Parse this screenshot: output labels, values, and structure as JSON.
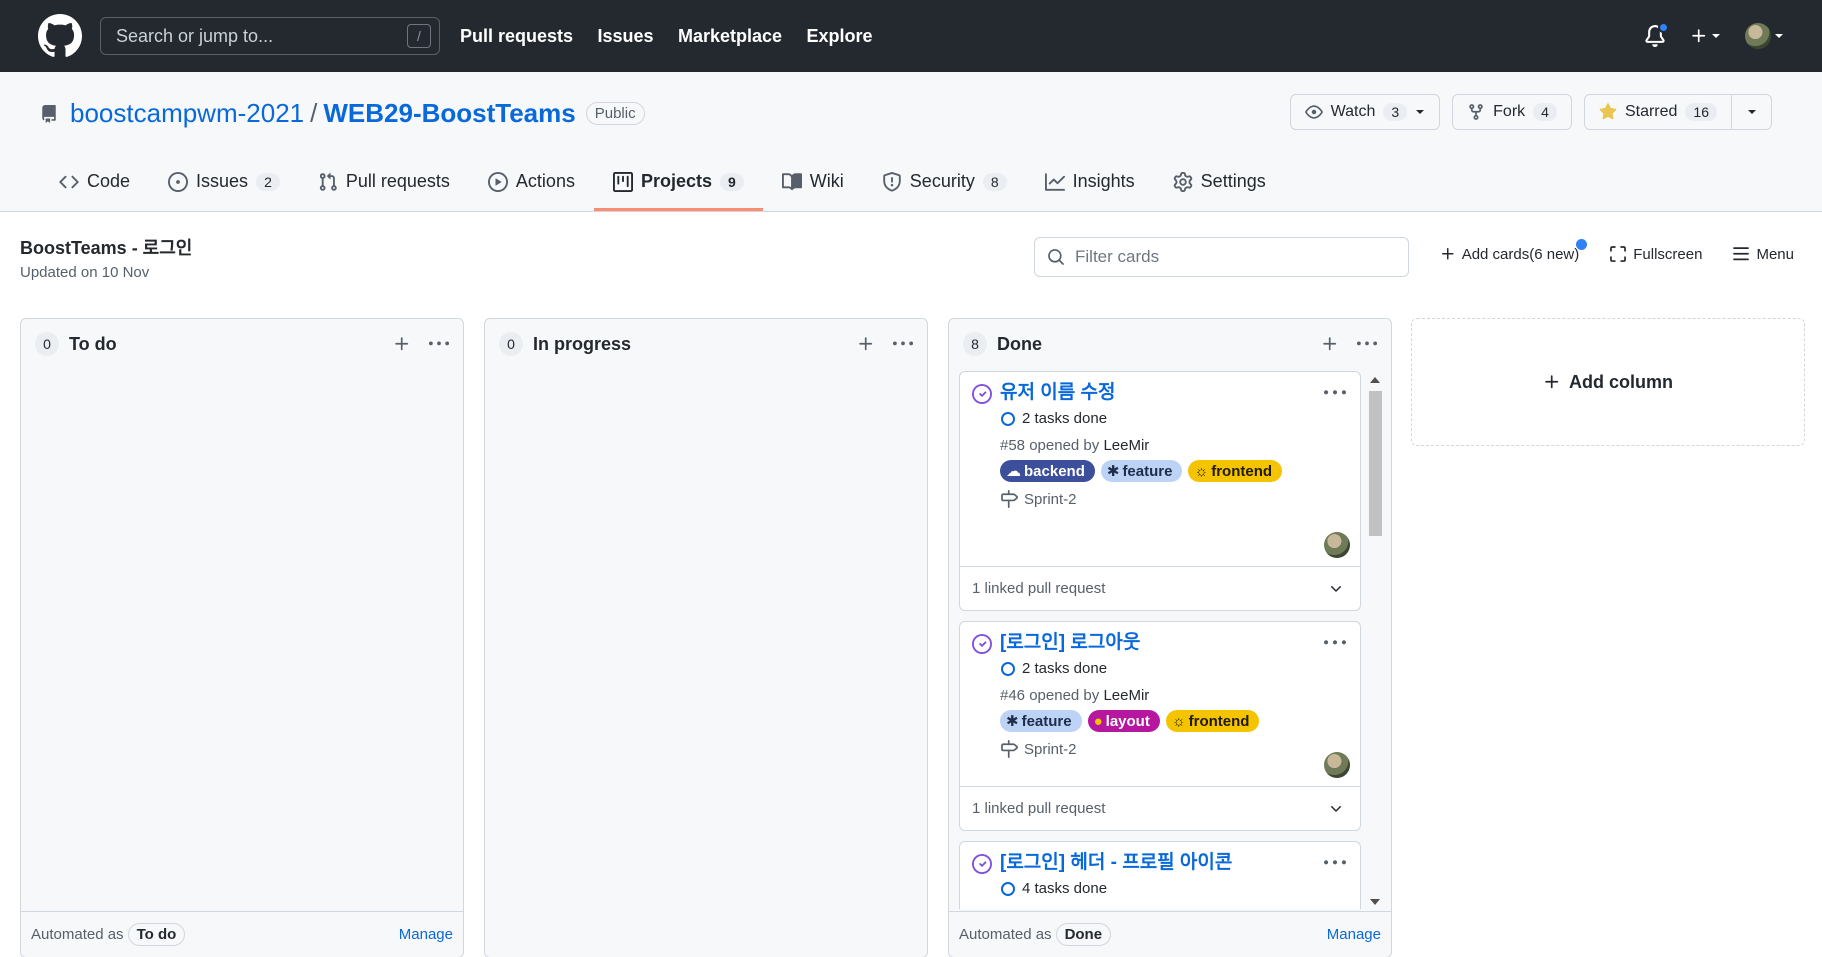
{
  "header": {
    "search_placeholder": "Search or jump to...",
    "search_shortcut": "/",
    "nav": [
      "Pull requests",
      "Issues",
      "Marketplace",
      "Explore"
    ]
  },
  "repo": {
    "owner": "boostcampwm-2021",
    "separator": "/",
    "name": "WEB29-BoostTeams",
    "visibility": "Public",
    "watch": {
      "label": "Watch",
      "count": "3"
    },
    "fork": {
      "label": "Fork",
      "count": "4"
    },
    "star": {
      "label": "Starred",
      "count": "16"
    }
  },
  "tabs": [
    {
      "label": "Code",
      "count": ""
    },
    {
      "label": "Issues",
      "count": "2"
    },
    {
      "label": "Pull requests",
      "count": ""
    },
    {
      "label": "Actions",
      "count": ""
    },
    {
      "label": "Projects",
      "count": "9"
    },
    {
      "label": "Wiki",
      "count": ""
    },
    {
      "label": "Security",
      "count": "8"
    },
    {
      "label": "Insights",
      "count": ""
    },
    {
      "label": "Settings",
      "count": ""
    }
  ],
  "project": {
    "title": "BoostTeams - 로그인",
    "updated": "Updated on 10 Nov",
    "filter_placeholder": "Filter cards",
    "add_cards": "Add cards(6 new)",
    "fullscreen": "Fullscreen",
    "menu": "Menu"
  },
  "columns": {
    "todo": {
      "count": "0",
      "title": "To do",
      "automated_label": "Automated as",
      "automated_value": "To do",
      "manage": "Manage"
    },
    "inprogress": {
      "count": "0",
      "title": "In progress"
    },
    "done": {
      "count": "8",
      "title": "Done",
      "automated_label": "Automated as",
      "automated_value": "Done",
      "manage": "Manage"
    }
  },
  "cards": [
    {
      "title": "유저 이름 수정",
      "tasks": "2 tasks done",
      "opened": "#58 opened by",
      "author": "LeeMir",
      "labels": [
        {
          "text": "backend",
          "bg": "#3b4f9a",
          "fg": "#ffffff",
          "emoji": "☁"
        },
        {
          "text": "feature",
          "bg": "#bcd3f5",
          "fg": "#1f2d4d",
          "emoji": "✱"
        },
        {
          "text": "frontend",
          "bg": "#f5c400",
          "fg": "#1f1a00",
          "emoji": "☼"
        }
      ],
      "milestone": "Sprint-2",
      "linked": "1 linked pull request"
    },
    {
      "title": "[로그인] 로그아웃",
      "tasks": "2 tasks done",
      "opened": "#46 opened by",
      "author": "LeeMir",
      "labels": [
        {
          "text": "feature",
          "bg": "#bcd3f5",
          "fg": "#1f2d4d",
          "emoji": "✱"
        },
        {
          "text": "layout",
          "bg": "#b5179e",
          "fg": "#ffffff",
          "emoji": "●"
        },
        {
          "text": "frontend",
          "bg": "#f5c400",
          "fg": "#1f1a00",
          "emoji": "☼"
        }
      ],
      "milestone": "Sprint-2",
      "linked": "1 linked pull request"
    },
    {
      "title": "[로그인] 헤더 - 프로필 아이콘",
      "tasks": "4 tasks done"
    }
  ],
  "add_column": "Add column"
}
